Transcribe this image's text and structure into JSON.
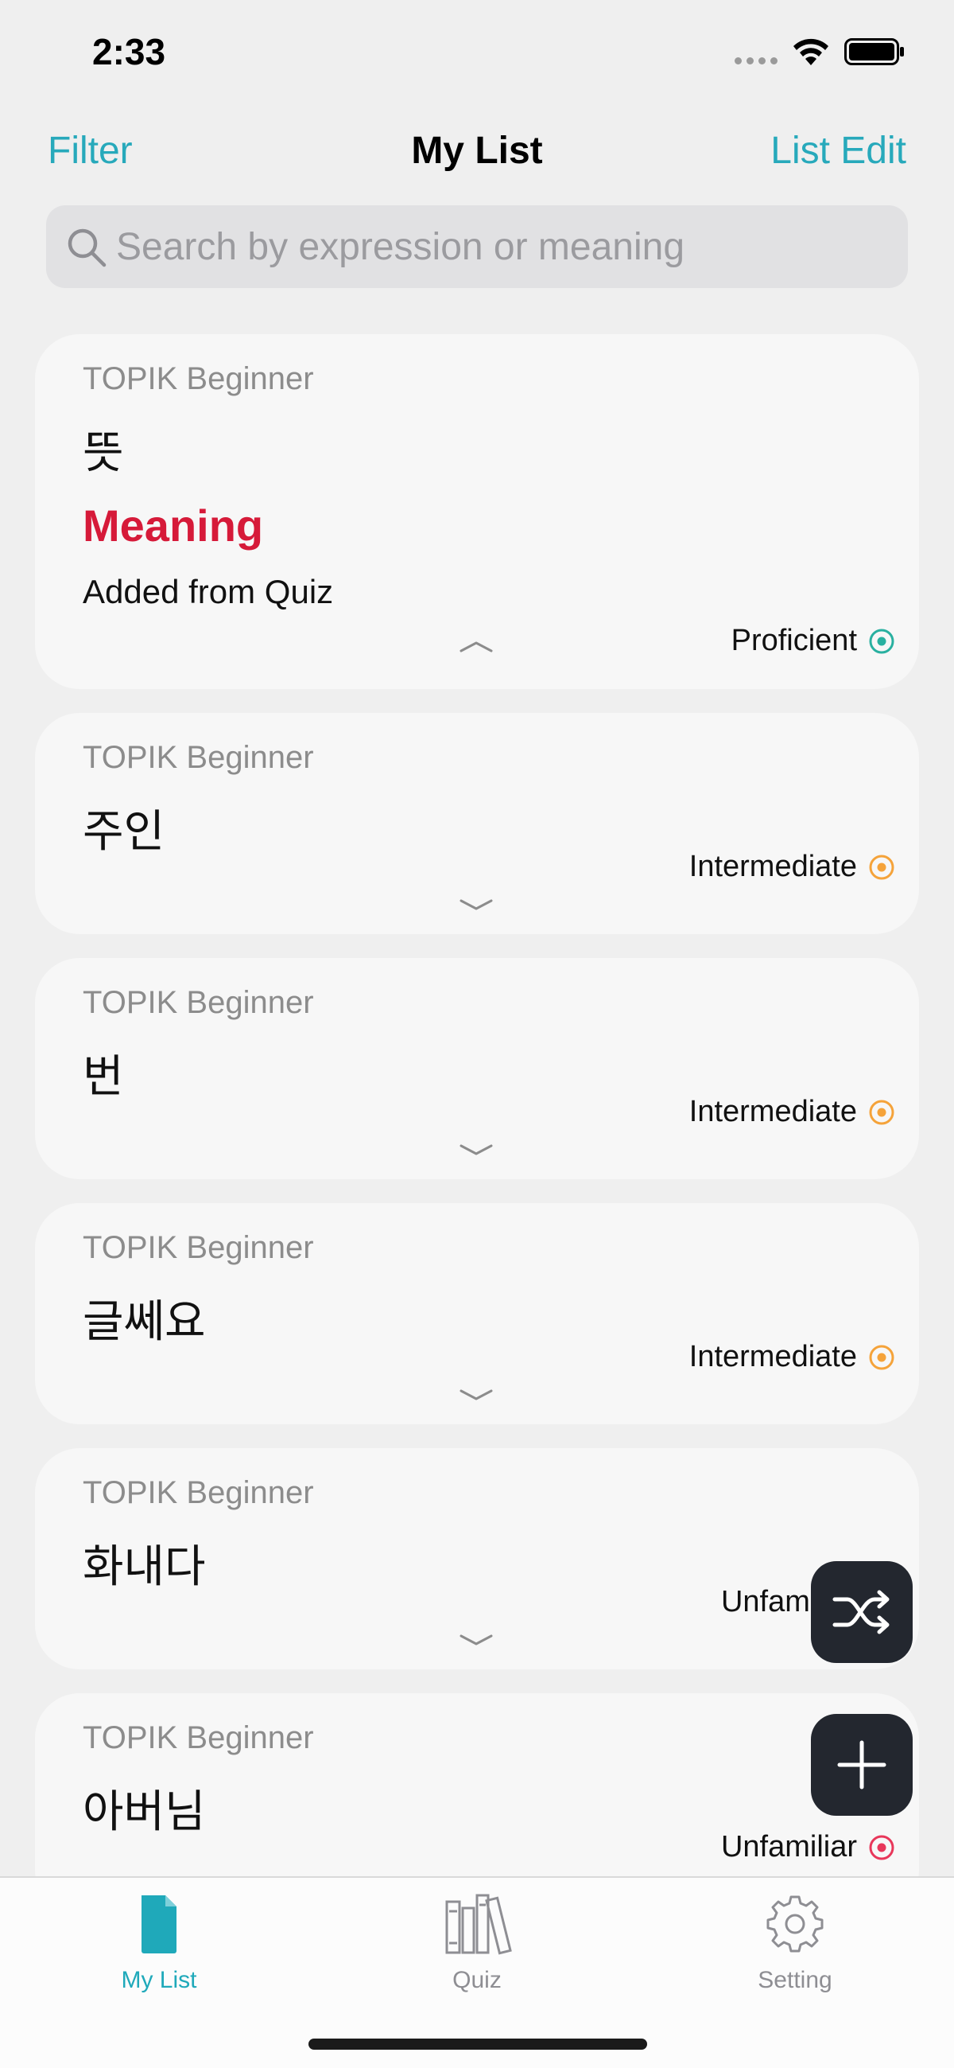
{
  "status_bar": {
    "time": "2:33"
  },
  "nav": {
    "filter_label": "Filter",
    "title": "My List",
    "edit_label": "List Edit"
  },
  "search": {
    "placeholder": "Search by expression or meaning",
    "value": ""
  },
  "colors": {
    "accent": "#27a9bb",
    "meaning_red": "#d61a39",
    "proficient": "#29b0a0",
    "intermediate": "#f5a33a",
    "unfamiliar": "#e8375a",
    "fab_bg": "#23272f"
  },
  "cards": [
    {
      "category": "TOPIK Beginner",
      "word": "뜻",
      "meaning": "Meaning",
      "note": "Added from Quiz",
      "status": "Proficient",
      "status_level": "proficient",
      "expanded": true
    },
    {
      "category": "TOPIK Beginner",
      "word": "주인",
      "status": "Intermediate",
      "status_level": "intermediate",
      "expanded": false
    },
    {
      "category": "TOPIK Beginner",
      "word": "번",
      "status": "Intermediate",
      "status_level": "intermediate",
      "expanded": false
    },
    {
      "category": "TOPIK Beginner",
      "word": "글쎄요",
      "status": "Intermediate",
      "status_level": "intermediate",
      "expanded": false
    },
    {
      "category": "TOPIK Beginner",
      "word": "화내다",
      "status": "Unfamiliar",
      "status_level": "unfamiliar",
      "expanded": false
    },
    {
      "category": "TOPIK Beginner",
      "word": "아버님",
      "status": "Unfamiliar",
      "status_level": "unfamiliar",
      "expanded": false
    }
  ],
  "fabs": {
    "shuffle_icon": "shuffle-icon",
    "add_icon": "plus-icon"
  },
  "tabs": [
    {
      "label": "My List",
      "icon": "document-icon",
      "active": true
    },
    {
      "label": "Quiz",
      "icon": "books-icon",
      "active": false
    },
    {
      "label": "Setting",
      "icon": "gear-icon",
      "active": false
    }
  ]
}
